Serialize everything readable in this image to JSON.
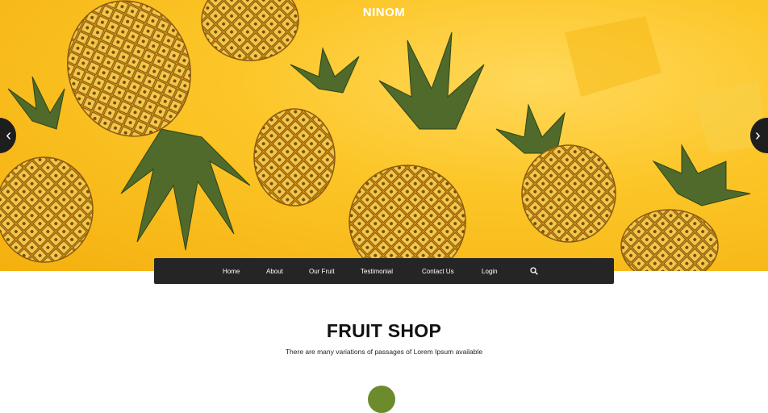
{
  "brand": "NINOM",
  "nav": {
    "items": [
      "Home",
      "About",
      "Our Fruit",
      "Testimonial",
      "Contact Us",
      "Login"
    ]
  },
  "hero": {
    "prev_icon": "chevron-left-icon",
    "next_icon": "chevron-right-icon",
    "prev_glyph": "‹",
    "next_glyph": "›"
  },
  "section": {
    "title": "FRUIT SHOP",
    "subtitle": "There are many variations of passages of Lorem Ipsum available"
  },
  "colors": {
    "accent": "#f8bf1d",
    "nav_bg": "#252525",
    "text": "#111111"
  }
}
